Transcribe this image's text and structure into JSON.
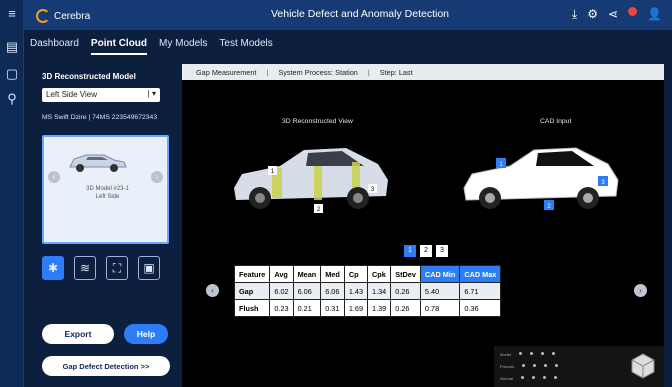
{
  "app": {
    "brand": "Cerebra",
    "title": "Vehicle Defect and Anomaly Detection"
  },
  "nav": {
    "items": [
      {
        "label": "Dashboard"
      },
      {
        "label": "Point Cloud"
      },
      {
        "label": "My Models"
      },
      {
        "label": "Test Models"
      }
    ]
  },
  "left_panel": {
    "title": "3D Reconstructed Model",
    "view_select": "Left Side View",
    "vehicle_info": "MS Swift Dzire | 74MS 223549672343",
    "card": {
      "line1": "3D Model #23-1",
      "line2": "Left Side"
    },
    "export_label": "Export",
    "help_label": "Help",
    "gap_label": "Gap Defect Detection >>"
  },
  "infobar": {
    "item1": "Gap Measurement",
    "item2": "System Process: Station",
    "item3": "Step: Last"
  },
  "views": {
    "left_title": "3D Reconstructed View",
    "right_title": "CAD Input",
    "left_markers": [
      "1",
      "2",
      "3"
    ],
    "right_markers": [
      "1",
      "2",
      "3"
    ]
  },
  "pagination": [
    "1",
    "2",
    "3"
  ],
  "table": {
    "headers": [
      "Feature",
      "Avg",
      "Mean",
      "Med",
      "Cp",
      "Cpk",
      "StDev",
      "CAD Min",
      "CAD Max"
    ],
    "rows": [
      [
        "Gap",
        "6.02",
        "6.06",
        "6.06",
        "1.43",
        "1.34",
        "0.26",
        "5.40",
        "6.71"
      ],
      [
        "Flush",
        "0.23",
        "0.21",
        "0.31",
        "1.69",
        "1.39",
        "0.26",
        "0.78",
        "0.36"
      ]
    ]
  },
  "legend": {
    "labels": [
      "Model",
      "Preload",
      "Normal"
    ]
  },
  "colors": {
    "accent": "#2d7df6",
    "header": "#163a74",
    "background": "#0c1f3f"
  }
}
